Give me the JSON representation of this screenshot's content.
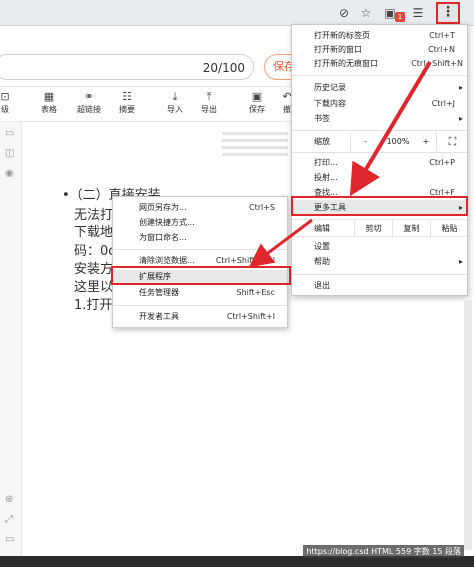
{
  "browser": {
    "ext_badge": "1",
    "icons": [
      "eye-off-icon",
      "star-icon",
      "extension-icon",
      "kebab-menu-icon"
    ]
  },
  "doc": {
    "word_count": "20/100",
    "save_label": "保存",
    "toolbar": [
      {
        "icon": "import-icon",
        "label": "级"
      },
      {
        "icon": "table-icon",
        "label": "表格"
      },
      {
        "icon": "link-icon",
        "label": "超链接"
      },
      {
        "icon": "summary-icon",
        "label": "摘要"
      },
      {
        "icon": "import-icon",
        "label": "导入"
      },
      {
        "icon": "export-icon",
        "label": "导出"
      },
      {
        "icon": "save-icon",
        "label": "保存"
      },
      {
        "icon": "more-icon",
        "label": "撤"
      }
    ],
    "content_lines": [
      "•（二）直接安装",
      "无法打",
      "下载地",
      "码：0c",
      "安装方",
      "这里以",
      "1.打开"
    ]
  },
  "submenu": {
    "items": [
      {
        "label": "网页另存为...",
        "shortcut": "Ctrl+S"
      },
      {
        "label": "创建快捷方式...",
        "shortcut": ""
      },
      {
        "label": "为窗口命名...",
        "shortcut": ""
      },
      {
        "label": "清除浏览数据...",
        "shortcut": "Ctrl+Shift+Del"
      },
      {
        "label": "扩展程序",
        "shortcut": ""
      },
      {
        "label": "任务管理器",
        "shortcut": "Shift+Esc"
      },
      {
        "label": "开发者工具",
        "shortcut": "Ctrl+Shift+I"
      }
    ]
  },
  "menu": {
    "new_tab": {
      "label": "打开新的标签页",
      "shortcut": "Ctrl+T"
    },
    "new_window": {
      "label": "打开新的窗口",
      "shortcut": "Ctrl+N"
    },
    "incognito": {
      "label": "打开新的无痕窗口",
      "shortcut": "Ctrl+Shift+N"
    },
    "history": {
      "label": "历史记录",
      "arrow": "▸"
    },
    "downloads": {
      "label": "下载内容",
      "shortcut": "Ctrl+J"
    },
    "bookmarks": {
      "label": "书签",
      "arrow": "▸"
    },
    "zoom": {
      "label": "缩放",
      "minus": "-",
      "value": "100%",
      "plus": "+",
      "fullscreen": "⛶"
    },
    "print": {
      "label": "打印...",
      "shortcut": "Ctrl+P"
    },
    "cast": {
      "label": "投射..."
    },
    "find": {
      "label": "查找...",
      "shortcut": "Ctrl+F"
    },
    "more_tools": {
      "label": "更多工具",
      "arrow": "▸"
    },
    "edit": {
      "label": "编辑",
      "cut": "剪切",
      "copy": "复制",
      "paste": "粘贴"
    },
    "settings": {
      "label": "设置"
    },
    "help": {
      "label": "帮助",
      "arrow": "▸"
    },
    "exit": {
      "label": "退出"
    }
  },
  "status": {
    "watermark": "HTML  559 字数  15 段落",
    "url_fragment": "https://blog.csd"
  },
  "colors": {
    "highlight": "#e0262d",
    "accent": "#e5573b"
  }
}
